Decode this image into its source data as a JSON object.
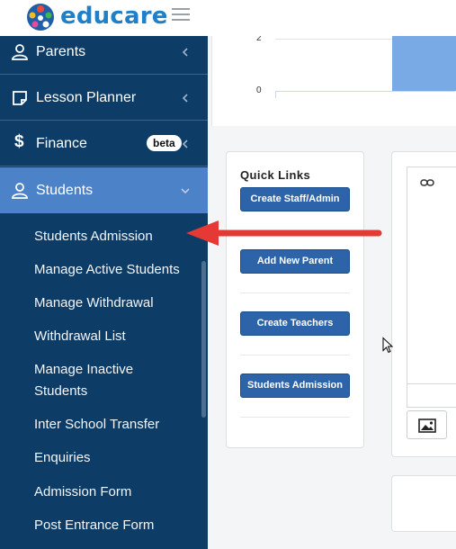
{
  "header": {
    "brand": "educare"
  },
  "sidebar": {
    "menu": [
      {
        "label": "Parents",
        "icon": "user-icon"
      },
      {
        "label": "Lesson Planner",
        "icon": "note-icon"
      },
      {
        "label": "Finance",
        "icon": "dollar-icon",
        "badge": "beta"
      },
      {
        "label": "Students",
        "icon": "user-icon",
        "active": true
      }
    ],
    "submenu": [
      "Students Admission",
      "Manage Active Students",
      "Manage Withdrawal",
      "Withdrawal List",
      "Manage Inactive Students",
      "Inter School Transfer",
      "Enquiries",
      "Admission Form",
      "Post Entrance Form"
    ]
  },
  "chart": {
    "y_ticks": [
      "2",
      "0"
    ]
  },
  "quick_links": {
    "title": "Quick Links",
    "buttons": [
      "Create Staff/Admin",
      "Add New Parent",
      "Create Teachers",
      "Students Admission"
    ]
  },
  "colors": {
    "sidebar": "#0d3c66",
    "active": "#4c82c8",
    "button": "#2d63a8",
    "arrow": "#e53935",
    "bar": "#7aaae6"
  }
}
